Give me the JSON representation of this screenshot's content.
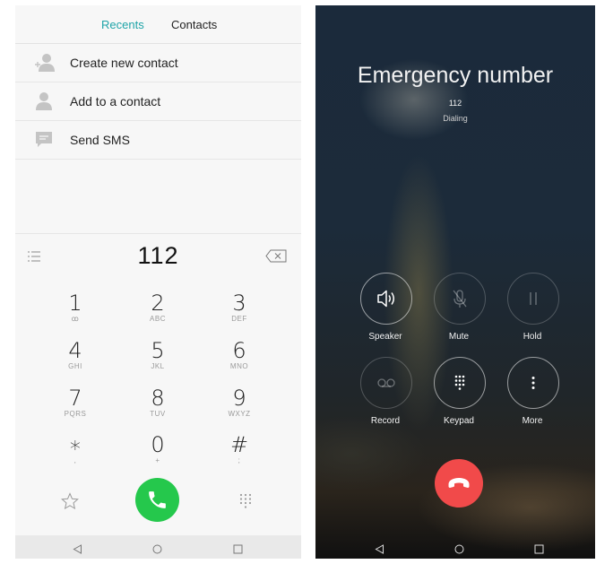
{
  "dialer": {
    "tabs": [
      {
        "label": "Recents",
        "active": true
      },
      {
        "label": "Contacts",
        "active": false
      }
    ],
    "menu": [
      {
        "label": "Create new contact",
        "icon": "add-contact-icon"
      },
      {
        "label": "Add to a contact",
        "icon": "contact-icon"
      },
      {
        "label": "Send SMS",
        "icon": "sms-icon"
      }
    ],
    "number": "112",
    "keys": [
      {
        "digit": "1",
        "letters": "ꝏ"
      },
      {
        "digit": "2",
        "letters": "ABC"
      },
      {
        "digit": "3",
        "letters": "DEF"
      },
      {
        "digit": "4",
        "letters": "GHI"
      },
      {
        "digit": "5",
        "letters": "JKL"
      },
      {
        "digit": "6",
        "letters": "MNO"
      },
      {
        "digit": "7",
        "letters": "PQRS"
      },
      {
        "digit": "8",
        "letters": "TUV"
      },
      {
        "digit": "9",
        "letters": "WXYZ"
      },
      {
        "digit": "∗",
        "letters": ","
      },
      {
        "digit": "0",
        "letters": "+"
      },
      {
        "digit": "#",
        "letters": ";"
      }
    ],
    "accent_color": "#1fa4a8",
    "call_button_color": "#25c84c"
  },
  "call_screen": {
    "title": "Emergency number",
    "number": "112",
    "status": "Dialing",
    "controls": [
      {
        "label": "Speaker",
        "icon": "speaker-icon",
        "enabled": true
      },
      {
        "label": "Mute",
        "icon": "mute-icon",
        "enabled": false
      },
      {
        "label": "Hold",
        "icon": "pause-icon",
        "enabled": false
      },
      {
        "label": "Record",
        "icon": "voicemail-icon",
        "enabled": false
      },
      {
        "label": "Keypad",
        "icon": "keypad-icon",
        "enabled": true
      },
      {
        "label": "More",
        "icon": "more-icon",
        "enabled": true
      }
    ],
    "end_button_color": "#f14a4a"
  },
  "navigation": [
    "back-icon",
    "home-icon",
    "recents-icon"
  ]
}
